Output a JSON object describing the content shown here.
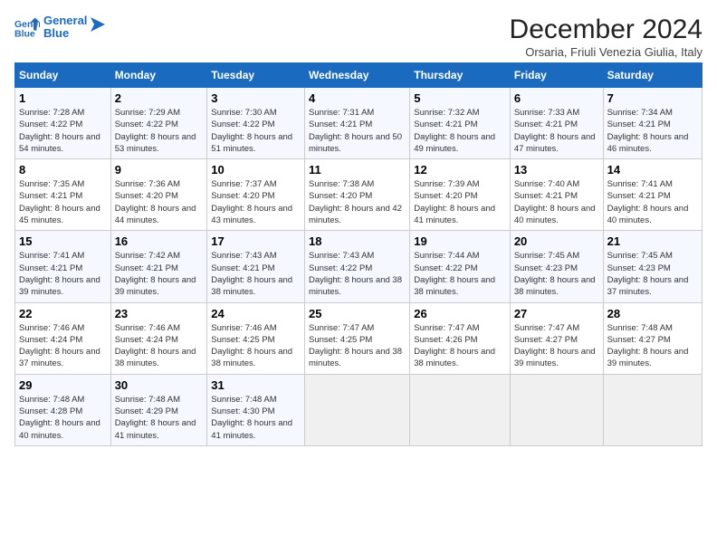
{
  "logo": {
    "line1": "General",
    "line2": "Blue"
  },
  "title": "December 2024",
  "subtitle": "Orsaria, Friuli Venezia Giulia, Italy",
  "days_of_week": [
    "Sunday",
    "Monday",
    "Tuesday",
    "Wednesday",
    "Thursday",
    "Friday",
    "Saturday"
  ],
  "weeks": [
    [
      {
        "day": "1",
        "sunrise": "7:28 AM",
        "sunset": "4:22 PM",
        "daylight": "8 hours and 54 minutes."
      },
      {
        "day": "2",
        "sunrise": "7:29 AM",
        "sunset": "4:22 PM",
        "daylight": "8 hours and 53 minutes."
      },
      {
        "day": "3",
        "sunrise": "7:30 AM",
        "sunset": "4:22 PM",
        "daylight": "8 hours and 51 minutes."
      },
      {
        "day": "4",
        "sunrise": "7:31 AM",
        "sunset": "4:21 PM",
        "daylight": "8 hours and 50 minutes."
      },
      {
        "day": "5",
        "sunrise": "7:32 AM",
        "sunset": "4:21 PM",
        "daylight": "8 hours and 49 minutes."
      },
      {
        "day": "6",
        "sunrise": "7:33 AM",
        "sunset": "4:21 PM",
        "daylight": "8 hours and 47 minutes."
      },
      {
        "day": "7",
        "sunrise": "7:34 AM",
        "sunset": "4:21 PM",
        "daylight": "8 hours and 46 minutes."
      }
    ],
    [
      {
        "day": "8",
        "sunrise": "7:35 AM",
        "sunset": "4:21 PM",
        "daylight": "8 hours and 45 minutes."
      },
      {
        "day": "9",
        "sunrise": "7:36 AM",
        "sunset": "4:20 PM",
        "daylight": "8 hours and 44 minutes."
      },
      {
        "day": "10",
        "sunrise": "7:37 AM",
        "sunset": "4:20 PM",
        "daylight": "8 hours and 43 minutes."
      },
      {
        "day": "11",
        "sunrise": "7:38 AM",
        "sunset": "4:20 PM",
        "daylight": "8 hours and 42 minutes."
      },
      {
        "day": "12",
        "sunrise": "7:39 AM",
        "sunset": "4:20 PM",
        "daylight": "8 hours and 41 minutes."
      },
      {
        "day": "13",
        "sunrise": "7:40 AM",
        "sunset": "4:21 PM",
        "daylight": "8 hours and 40 minutes."
      },
      {
        "day": "14",
        "sunrise": "7:41 AM",
        "sunset": "4:21 PM",
        "daylight": "8 hours and 40 minutes."
      }
    ],
    [
      {
        "day": "15",
        "sunrise": "7:41 AM",
        "sunset": "4:21 PM",
        "daylight": "8 hours and 39 minutes."
      },
      {
        "day": "16",
        "sunrise": "7:42 AM",
        "sunset": "4:21 PM",
        "daylight": "8 hours and 39 minutes."
      },
      {
        "day": "17",
        "sunrise": "7:43 AM",
        "sunset": "4:21 PM",
        "daylight": "8 hours and 38 minutes."
      },
      {
        "day": "18",
        "sunrise": "7:43 AM",
        "sunset": "4:22 PM",
        "daylight": "8 hours and 38 minutes."
      },
      {
        "day": "19",
        "sunrise": "7:44 AM",
        "sunset": "4:22 PM",
        "daylight": "8 hours and 38 minutes."
      },
      {
        "day": "20",
        "sunrise": "7:45 AM",
        "sunset": "4:23 PM",
        "daylight": "8 hours and 38 minutes."
      },
      {
        "day": "21",
        "sunrise": "7:45 AM",
        "sunset": "4:23 PM",
        "daylight": "8 hours and 37 minutes."
      }
    ],
    [
      {
        "day": "22",
        "sunrise": "7:46 AM",
        "sunset": "4:24 PM",
        "daylight": "8 hours and 37 minutes."
      },
      {
        "day": "23",
        "sunrise": "7:46 AM",
        "sunset": "4:24 PM",
        "daylight": "8 hours and 38 minutes."
      },
      {
        "day": "24",
        "sunrise": "7:46 AM",
        "sunset": "4:25 PM",
        "daylight": "8 hours and 38 minutes."
      },
      {
        "day": "25",
        "sunrise": "7:47 AM",
        "sunset": "4:25 PM",
        "daylight": "8 hours and 38 minutes."
      },
      {
        "day": "26",
        "sunrise": "7:47 AM",
        "sunset": "4:26 PM",
        "daylight": "8 hours and 38 minutes."
      },
      {
        "day": "27",
        "sunrise": "7:47 AM",
        "sunset": "4:27 PM",
        "daylight": "8 hours and 39 minutes."
      },
      {
        "day": "28",
        "sunrise": "7:48 AM",
        "sunset": "4:27 PM",
        "daylight": "8 hours and 39 minutes."
      }
    ],
    [
      {
        "day": "29",
        "sunrise": "7:48 AM",
        "sunset": "4:28 PM",
        "daylight": "8 hours and 40 minutes."
      },
      {
        "day": "30",
        "sunrise": "7:48 AM",
        "sunset": "4:29 PM",
        "daylight": "8 hours and 41 minutes."
      },
      {
        "day": "31",
        "sunrise": "7:48 AM",
        "sunset": "4:30 PM",
        "daylight": "8 hours and 41 minutes."
      },
      null,
      null,
      null,
      null
    ]
  ],
  "labels": {
    "sunrise": "Sunrise:",
    "sunset": "Sunset:",
    "daylight": "Daylight:"
  }
}
